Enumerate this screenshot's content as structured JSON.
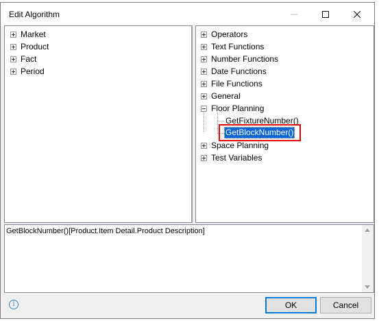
{
  "window": {
    "title": "Edit Algorithm"
  },
  "left_tree": {
    "items": [
      {
        "label": "Market"
      },
      {
        "label": "Product"
      },
      {
        "label": "Fact"
      },
      {
        "label": "Period"
      }
    ]
  },
  "right_tree": {
    "items": [
      {
        "label": "Operators"
      },
      {
        "label": "Text Functions"
      },
      {
        "label": "Number Functions"
      },
      {
        "label": "Date Functions"
      },
      {
        "label": "File Functions"
      },
      {
        "label": "General"
      },
      {
        "label": "Floor Planning"
      },
      {
        "label": "GetFixtureNumber()"
      },
      {
        "label": "GetBlockNumber()"
      },
      {
        "label": "Space Planning"
      },
      {
        "label": "Test Variables"
      }
    ],
    "selected": "GetBlockNumber()"
  },
  "expression": {
    "value": "GetBlockNumber()[Product.Item Detail.Product Description]"
  },
  "buttons": {
    "ok": "OK",
    "cancel": "Cancel"
  },
  "colors": {
    "selection": "#0a64d4",
    "highlight_border": "#e00000",
    "accent": "#0078d7"
  }
}
